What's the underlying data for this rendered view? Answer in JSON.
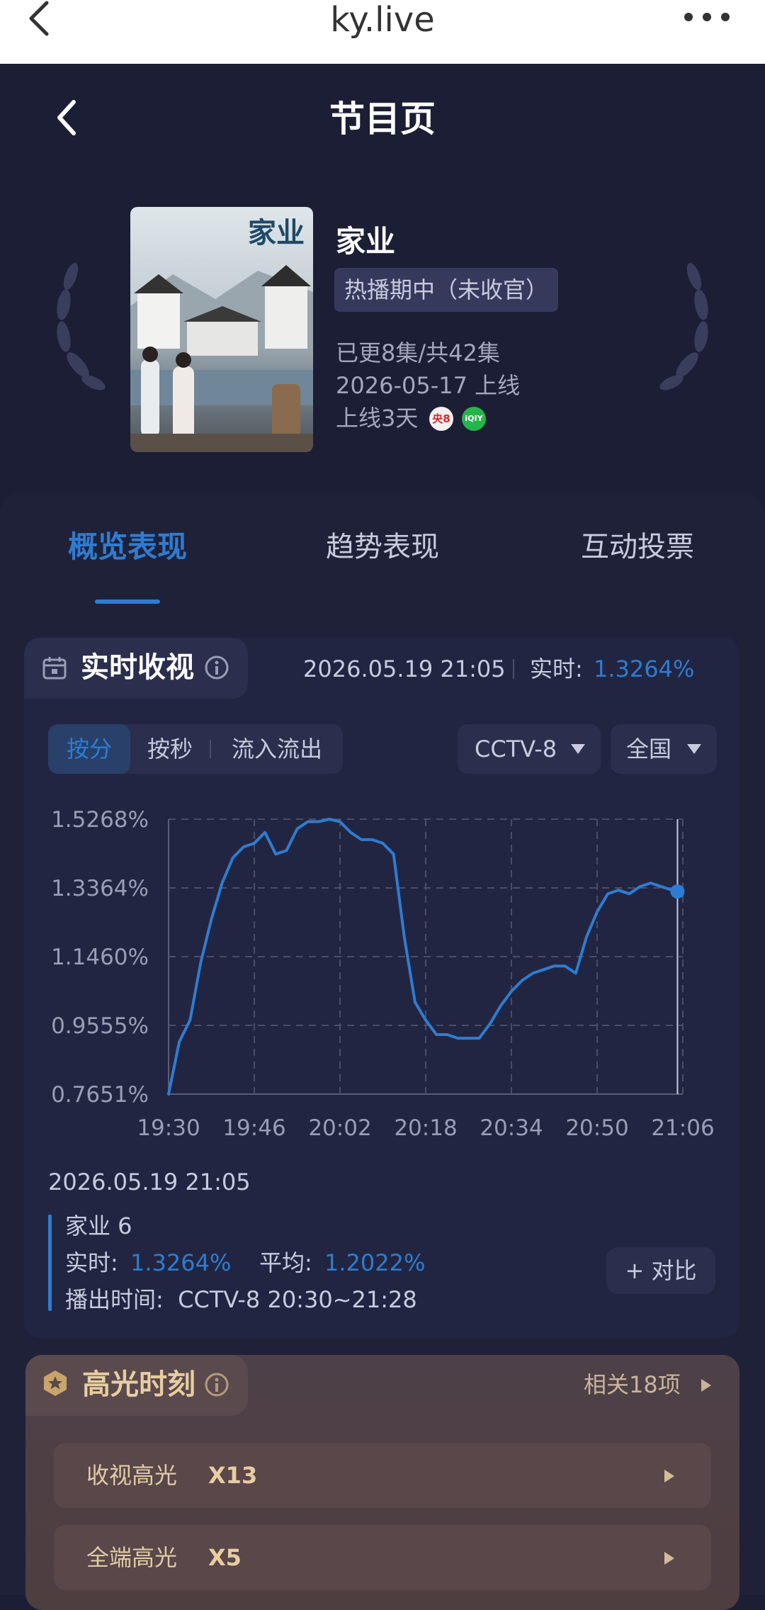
{
  "browser": {
    "url": "ky.live"
  },
  "header": {
    "title": "节目页"
  },
  "show": {
    "poster_title": "家业",
    "name": "家业",
    "status": "热播期中（未收官）",
    "episodes": "已更8集/共42集",
    "release": "2026-05-17 上线",
    "days": "上线3天",
    "channel_badge": "央8",
    "platform_badge": "iQIY"
  },
  "tabs": [
    {
      "label": "概览表现",
      "active": true
    },
    {
      "label": "趋势表现",
      "active": false
    },
    {
      "label": "互动投票",
      "active": false
    }
  ],
  "realtime": {
    "title": "实时收视",
    "timestamp": "2026.05.19 21:05",
    "live_label": "实时:",
    "live_value": "1.3264%",
    "modes": [
      "按分",
      "按秒",
      "流入流出"
    ],
    "channel": "CCTV-8",
    "region": "全国"
  },
  "chart_data": {
    "type": "line",
    "x": [
      "19:30",
      "19:32",
      "19:34",
      "19:36",
      "19:38",
      "19:40",
      "19:42",
      "19:44",
      "19:46",
      "19:48",
      "19:50",
      "19:52",
      "19:54",
      "19:56",
      "19:58",
      "20:00",
      "20:02",
      "20:04",
      "20:06",
      "20:08",
      "20:10",
      "20:12",
      "20:14",
      "20:16",
      "20:18",
      "20:20",
      "20:22",
      "20:24",
      "20:26",
      "20:28",
      "20:30",
      "20:32",
      "20:34",
      "20:36",
      "20:38",
      "20:40",
      "20:42",
      "20:44",
      "20:46",
      "20:48",
      "20:50",
      "20:52",
      "20:54",
      "20:56",
      "20:58",
      "21:00",
      "21:02",
      "21:04",
      "21:05"
    ],
    "values": [
      0.7651,
      0.91,
      0.97,
      1.13,
      1.25,
      1.35,
      1.42,
      1.45,
      1.46,
      1.49,
      1.43,
      1.44,
      1.5,
      1.52,
      1.52,
      1.5268,
      1.52,
      1.49,
      1.47,
      1.47,
      1.46,
      1.43,
      1.2,
      1.02,
      0.97,
      0.93,
      0.93,
      0.92,
      0.92,
      0.92,
      0.96,
      1.01,
      1.05,
      1.08,
      1.1,
      1.11,
      1.12,
      1.12,
      1.1,
      1.2,
      1.27,
      1.32,
      1.33,
      1.32,
      1.34,
      1.35,
      1.34,
      1.33,
      1.3264
    ],
    "yticks": [
      "1.5268%",
      "1.3364%",
      "1.1460%",
      "0.9555%",
      "0.7651%"
    ],
    "xticks": [
      "19:30",
      "19:46",
      "20:02",
      "20:18",
      "20:34",
      "20:50",
      "21:06"
    ],
    "ylim": [
      0.7651,
      1.5268
    ],
    "grid": true,
    "color": "#2e7cd1"
  },
  "info": {
    "timestamp": "2026.05.19 21:05",
    "episode": "家业 6",
    "live_label": "实时:",
    "live_value": "1.3264%",
    "avg_label": "平均:",
    "avg_value": "1.2022%",
    "airtime": "播出时间:  CCTV-8 20:30~21:28",
    "compare_button": "+ 对比"
  },
  "highlights": {
    "title": "高光时刻",
    "related": "相关18项",
    "items": [
      {
        "label": "收视高光",
        "count": "X13"
      },
      {
        "label": "全端高光",
        "count": "X5"
      }
    ]
  },
  "colors": {
    "accent": "#2e7cd1",
    "bg": "#1c1e35",
    "gold": "#c9a56a"
  }
}
